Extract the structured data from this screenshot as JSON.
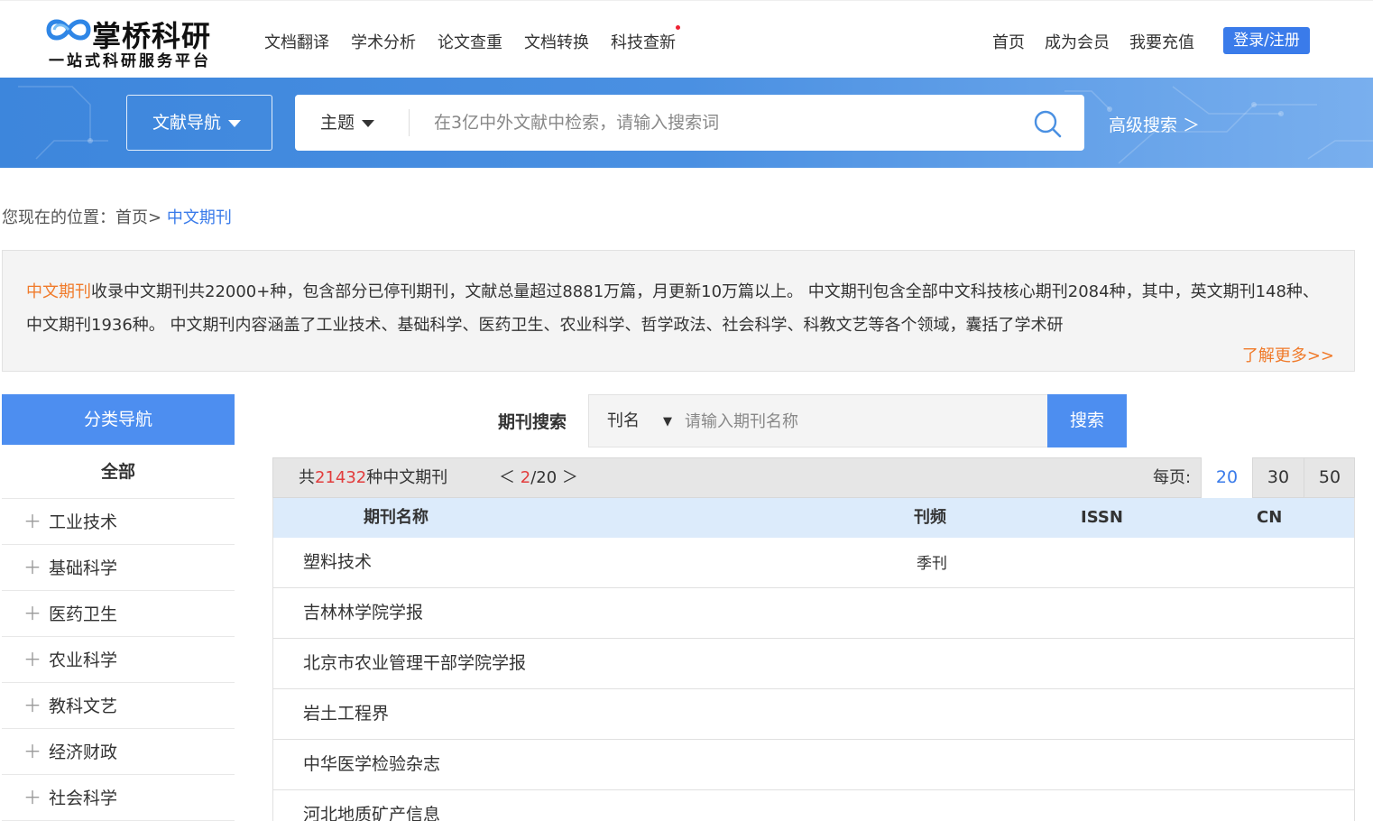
{
  "brand": {
    "title": "掌桥科研",
    "subtitle": "一站式科研服务平台",
    "accent": "#3a7bea"
  },
  "main_nav": [
    "文档翻译",
    "学术分析",
    "论文查重",
    "文档转换",
    "科技查新"
  ],
  "right_nav": [
    "首页",
    "成为会员",
    "我要充值"
  ],
  "login_label": "登录/注册",
  "search": {
    "literature_nav": "文献导航",
    "type": "主题",
    "placeholder": "在3亿中外文献中检索，请输入搜索词",
    "advanced": "高级搜索 ＞"
  },
  "breadcrumb": {
    "prefix": "您现在的位置：",
    "home": "首页>",
    "current": " 中文期刊"
  },
  "intro": {
    "highlight": "中文期刊",
    "text": "收录中文期刊共22000+种，包含部分已停刊期刊，文献总量超过8881万篇，月更新10万篇以上。 中文期刊包含全部中文科技核心期刊2084种，其中，英文期刊148种、中文期刊1936种。 中文期刊内容涵盖了工业技术、基础科学、医药卫生、农业科学、哲学政法、社会科学、科教文艺等各个领域，囊括了学术研",
    "more": "了解更多>>"
  },
  "sidebar": {
    "header": "分类导航",
    "all": "全部",
    "items": [
      "工业技术",
      "基础科学",
      "医药卫生",
      "农业科学",
      "教科文艺",
      "经济财政",
      "社会科学"
    ]
  },
  "journal_search": {
    "label": "期刊搜索",
    "field": "刊名",
    "placeholder": "请输入期刊名称",
    "button": "搜索"
  },
  "table": {
    "total_prefix": "共",
    "total_count": "21432",
    "total_suffix": "种中文期刊",
    "pager_prev": "＜ ",
    "page_current": "2",
    "page_total": "/20",
    "pager_next": " ＞",
    "per_page_label": "每页:",
    "per_page_options": [
      "20",
      "30",
      "50"
    ],
    "columns": [
      "期刊名称",
      "刊频",
      "ISSN",
      "CN"
    ],
    "rows": [
      {
        "name": "塑料技术",
        "freq": "季刊",
        "issn": "",
        "cn": ""
      },
      {
        "name": "吉林林学院学报",
        "freq": "",
        "issn": "",
        "cn": ""
      },
      {
        "name": "北京市农业管理干部学院学报",
        "freq": "",
        "issn": "",
        "cn": ""
      },
      {
        "name": "岩土工程界",
        "freq": "",
        "issn": "",
        "cn": ""
      },
      {
        "name": "中华医学检验杂志",
        "freq": "",
        "issn": "",
        "cn": ""
      },
      {
        "name": "河北地质矿产信息",
        "freq": "",
        "issn": "",
        "cn": ""
      }
    ]
  }
}
